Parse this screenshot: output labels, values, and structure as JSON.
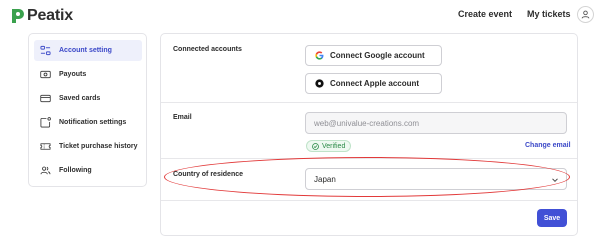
{
  "header": {
    "logo_text": "Peatix",
    "nav": {
      "create_event": "Create event",
      "my_tickets": "My tickets"
    }
  },
  "sidebar": {
    "items": [
      {
        "label": "Account setting",
        "icon": "settings-sliders-icon",
        "active": true
      },
      {
        "label": "Payouts",
        "icon": "money-bill-icon",
        "active": false
      },
      {
        "label": "Saved cards",
        "icon": "credit-card-icon",
        "active": false
      },
      {
        "label": "Notification settings",
        "icon": "notification-icon",
        "active": false
      },
      {
        "label": "Ticket purchase history",
        "icon": "ticket-icon",
        "active": false
      },
      {
        "label": "Following",
        "icon": "people-icon",
        "active": false
      }
    ]
  },
  "main": {
    "connected_accounts": {
      "label": "Connected accounts",
      "google_button": "Connect Google account",
      "apple_button": "Connect Apple account"
    },
    "email": {
      "label": "Email",
      "value": "web@univalue-creations.com",
      "verified_badge": "Verified",
      "change_link": "Change email"
    },
    "country": {
      "label": "Country of residence",
      "selected": "Japan"
    },
    "save_button": "Save"
  },
  "colors": {
    "accent": "#4150d6",
    "logo_green": "#3aa14d",
    "verified_green": "#2a8a47",
    "highlight_red": "#e23a3a"
  }
}
